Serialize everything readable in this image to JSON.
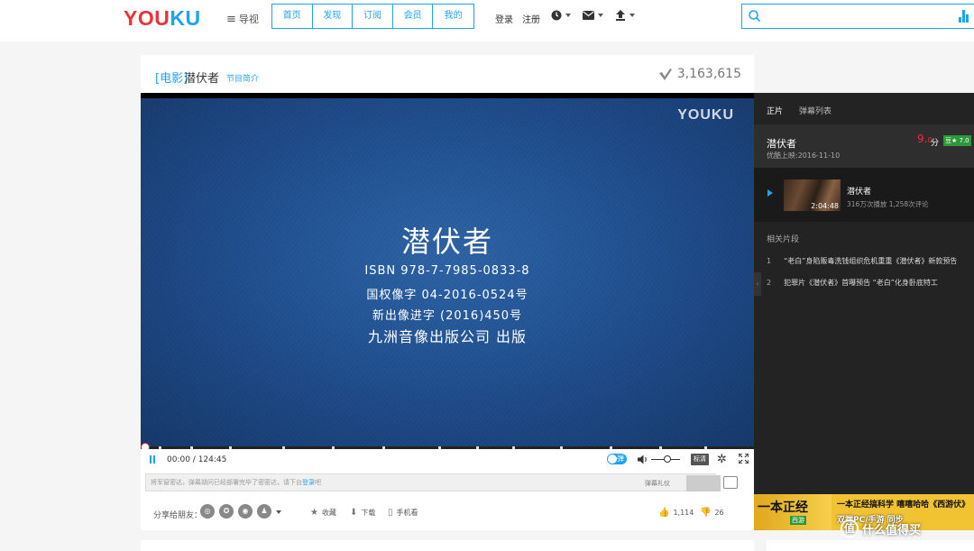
{
  "header": {
    "logo_part1": "YOU",
    "logo_part2": "KU",
    "guide_label": "导视",
    "nav_tabs": [
      "首页",
      "发现",
      "订阅",
      "会员",
      "我的"
    ],
    "login": "登录",
    "register": "注册",
    "search_placeholder": ""
  },
  "title": {
    "category": "[电影]",
    "name": "潜伏者",
    "intro_link": "节目简介",
    "view_count": "3,163,615"
  },
  "video": {
    "watermark": "YOUKU",
    "screen_title": "潜伏者",
    "lines": [
      "ISBN 978-7-7985-0833-8",
      "国权像字 04-2016-0524号",
      "新出像进字 (2016)450号",
      "九洲音像出版公司 出版"
    ]
  },
  "controls": {
    "time": "00:00 / 124:45",
    "progress": 0,
    "danmu_toggle": "弹",
    "quality": "标清",
    "volume_level": 0.45
  },
  "danmu": {
    "placeholder_text": "将军窗密达，弹幕胡问已经部署完毕了密密达，请下台",
    "placeholder_link": "登录",
    "placeholder_tail": "吧",
    "gift": "弹幕礼仪"
  },
  "share": {
    "label": "分享给朋友：",
    "collect": "收藏",
    "download": "下载",
    "mobile": "手机看",
    "likes": "1,114",
    "dislikes": "26"
  },
  "sidebar": {
    "tab_main": "正片",
    "tab_danmu": "弹幕列表",
    "movie_name": "潜伏者",
    "release_date": "优酷上映:2016-11-10",
    "score_int": "9.",
    "score_dec": "0",
    "score_unit": "分",
    "douban": "豆★ 7.0",
    "episode": {
      "name": "潜伏者",
      "duration": "2:04:48",
      "stats": "316万次播放 1,258次评论"
    },
    "related_title": "相关片段",
    "related": [
      {
        "num": "1",
        "text": "“老白”身陷贩毒洗钱组织危机重重《潜伏者》新款预告"
      },
      {
        "num": "2",
        "text": "犯罪片《潜伏者》首曝预告 “老白”化身卧底特工"
      }
    ]
  },
  "ad": {
    "title": "一本正经",
    "tag": "西游",
    "text": "一本正经搞科学 嘻嘻哈哈《西游伏》",
    "sub": "双端PC/手游 同步"
  },
  "brand_overlay": "什么值得买"
}
